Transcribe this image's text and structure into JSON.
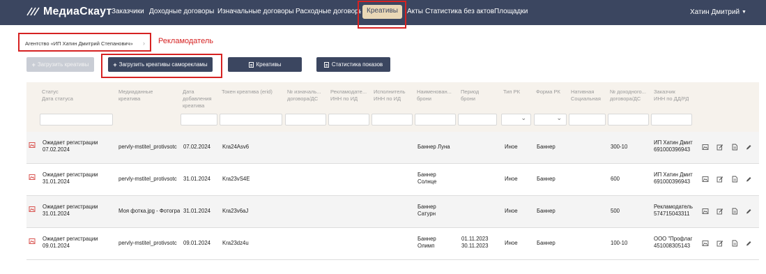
{
  "app": {
    "logo_text": "МедиаСкаут"
  },
  "nav": {
    "items": [
      "Заказчики",
      "Доходные договоры",
      "Изначальные договоры",
      "Расходные договоры",
      "Креативы",
      "Акты",
      "Статистика без актов",
      "Площадки"
    ],
    "active_index": 4,
    "user_name": "Хатин Дмитрий"
  },
  "breadcrumb": {
    "text": "Агентство «ИП Хатин Дмитрий Степанович»"
  },
  "annotation": {
    "advertiser_label": "Рекламодатель",
    "color": "#d62222"
  },
  "toolbar": {
    "upload_creatives": "Загрузить креативы",
    "upload_self_ad": "Загрузить креативы саморекламы",
    "creatives": "Креативы",
    "impressions_stats": "Статистика показов"
  },
  "table": {
    "headers": [
      {
        "line1": "Статус",
        "line2": "Дата статуса"
      },
      {
        "line1": "Медиаданные",
        "line2": "креатива"
      },
      {
        "line1": "Дата",
        "line2": "добавления",
        "line3": "креатива"
      },
      {
        "line1": "Токен креатива (erid)"
      },
      {
        "line1": "№ изначаль...",
        "line2": "договора/ДС"
      },
      {
        "line1": "Рекламодате...",
        "line2": "ИНН по ИД"
      },
      {
        "line1": "Исполнитель",
        "line2": "ИНН по ИД"
      },
      {
        "line1": "Наименован...",
        "line2": "брони"
      },
      {
        "line1": "Период",
        "line2": "брони"
      },
      {
        "line1": "Тип РК"
      },
      {
        "line1": "Форма РК"
      },
      {
        "line1": "Нативная",
        "line2": "Социальная"
      },
      {
        "line1": "№ доходного...",
        "line2": "договора/ДС"
      },
      {
        "line1": "Заказчик",
        "line2": "ИНН по ДД/РД"
      }
    ],
    "rows": [
      {
        "status": "Ожидает регистрации",
        "status_date": "07.02.2024",
        "media": "pervly-mstitel_protivsotc",
        "date_added": "07.02.2024",
        "token": "Kra24Asv6",
        "booking_name_1": "Баннер Луна",
        "booking_name_2": "",
        "period_1": "",
        "period_2": "",
        "rk_type": "Иное",
        "rk_form": "Баннер",
        "income_contract": "300-10",
        "customer": "ИП Хатин Дмит",
        "customer_inn": "691000396943"
      },
      {
        "status": "Ожидает регистрации",
        "status_date": "31.01.2024",
        "media": "pervly-mstitel_protivsotc",
        "date_added": "31.01.2024",
        "token": "Kra23vS4E",
        "booking_name_1": "Баннер",
        "booking_name_2": "Солнце",
        "period_1": "",
        "period_2": "",
        "rk_type": "Иное",
        "rk_form": "Баннер",
        "income_contract": "600",
        "customer": "ИП Хатин Дмит",
        "customer_inn": "691000396943"
      },
      {
        "status": "Ожидает регистрации",
        "status_date": "31.01.2024",
        "media": "Моя фотка.jpg - Фотогра",
        "date_added": "31.01.2024",
        "token": "Kra23v6aJ",
        "booking_name_1": "Баннер",
        "booking_name_2": "Сатурн",
        "period_1": "",
        "period_2": "",
        "rk_type": "Иное",
        "rk_form": "Баннер",
        "income_contract": "500",
        "customer": "Рекламодатель",
        "customer_inn": "574715043311"
      },
      {
        "status": "Ожидает регистрации",
        "status_date": "09.01.2024",
        "media": "pervly-mstitel_protivsotc",
        "date_added": "09.01.2024",
        "token": "Kra23dz4u",
        "booking_name_1": "Баннер",
        "booking_name_2": "Олимп",
        "period_1": "01.11.2023",
        "period_2": "30.11.2023",
        "rk_type": "Иное",
        "rk_form": "Баннер",
        "income_contract": "100-10",
        "customer": "ООО \"Профлаг",
        "customer_inn": "451008305143"
      }
    ]
  },
  "icons": {
    "status": "status-image-icon",
    "row_actions": [
      "gallery-icon",
      "edit-note-icon",
      "document-icon",
      "pencil-icon"
    ]
  }
}
